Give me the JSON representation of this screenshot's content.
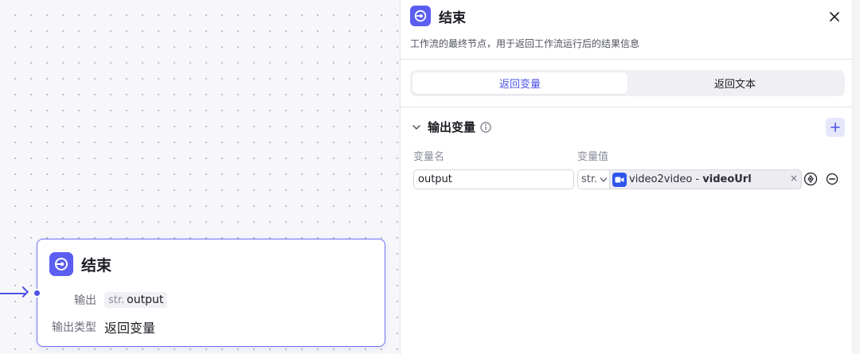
{
  "node": {
    "title": "结束",
    "output_label": "输出",
    "output_type_tag": "str.",
    "output_var": "output",
    "output_kind_label": "输出类型",
    "output_kind_value": "返回变量"
  },
  "panel": {
    "title": "结束",
    "description": "工作流的最终节点，用于返回工作流运行后的结果信息",
    "tabs": [
      {
        "label": "返回变量",
        "active": true
      },
      {
        "label": "返回文本",
        "active": false
      }
    ],
    "section_title": "输出变量",
    "columns": {
      "name": "变量名",
      "value": "变量值"
    },
    "rows": [
      {
        "name": "output",
        "type": "str.",
        "ref_node": "video2video",
        "ref_separator": " - ",
        "ref_var": "videoUrl",
        "clear_glyph": "×"
      }
    ]
  },
  "colors": {
    "accent": "#4d53e8",
    "node_icon_bg": "#5b5ef0",
    "ref_icon_bg": "#2f54eb"
  },
  "icons": [
    "end-node-icon",
    "close-icon",
    "chevron-down-icon",
    "info-icon",
    "plus-icon",
    "video-icon",
    "target-icon",
    "minus-circle-icon"
  ]
}
